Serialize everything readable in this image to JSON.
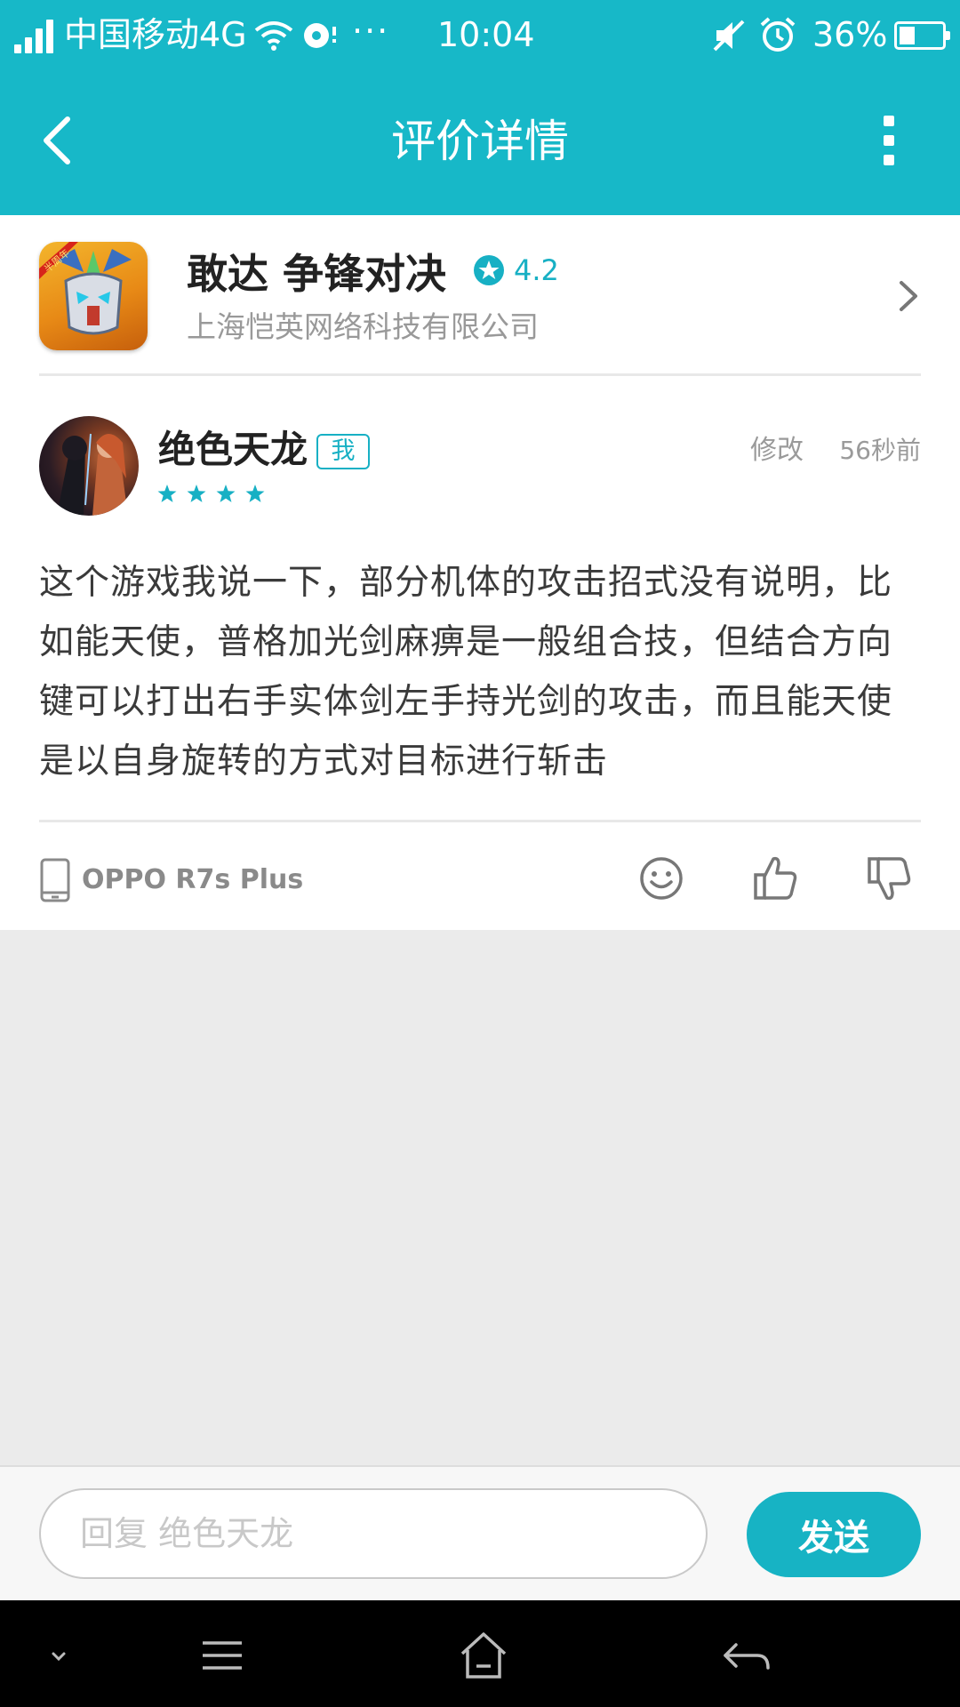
{
  "status_bar": {
    "carrier": "中国移动4G",
    "more": "···",
    "time": "10:04",
    "battery_percent": "36%",
    "battery_level": 0.36
  },
  "header": {
    "title": "评价详情",
    "back_icon": "chevron-left-icon",
    "more_icon": "more-vertical-icon"
  },
  "app": {
    "name": "敢达 争锋对决",
    "rating": "4.2",
    "developer": "上海恺英网络科技有限公司",
    "icon": "app-icon-gundam"
  },
  "review": {
    "user_name": "绝色天龙",
    "me_badge": "我",
    "star_count": 4,
    "edit_label": "修改",
    "time_ago": "56秒前",
    "text": "这个游戏我说一下，部分机体的攻击招式没有说明，比如能天使，普格加光剑麻痹是一般组合技，但结合方向键可以打出右手实体剑左手持光剑的攻击，而且能天使是以自身旋转的方式对目标进行斩击",
    "device": "OPPO R7s Plus"
  },
  "reply": {
    "placeholder": "回复 绝色天龙",
    "send_label": "发送"
  },
  "colors": {
    "accent": "#17b8c8",
    "background": "#ebebeb"
  }
}
